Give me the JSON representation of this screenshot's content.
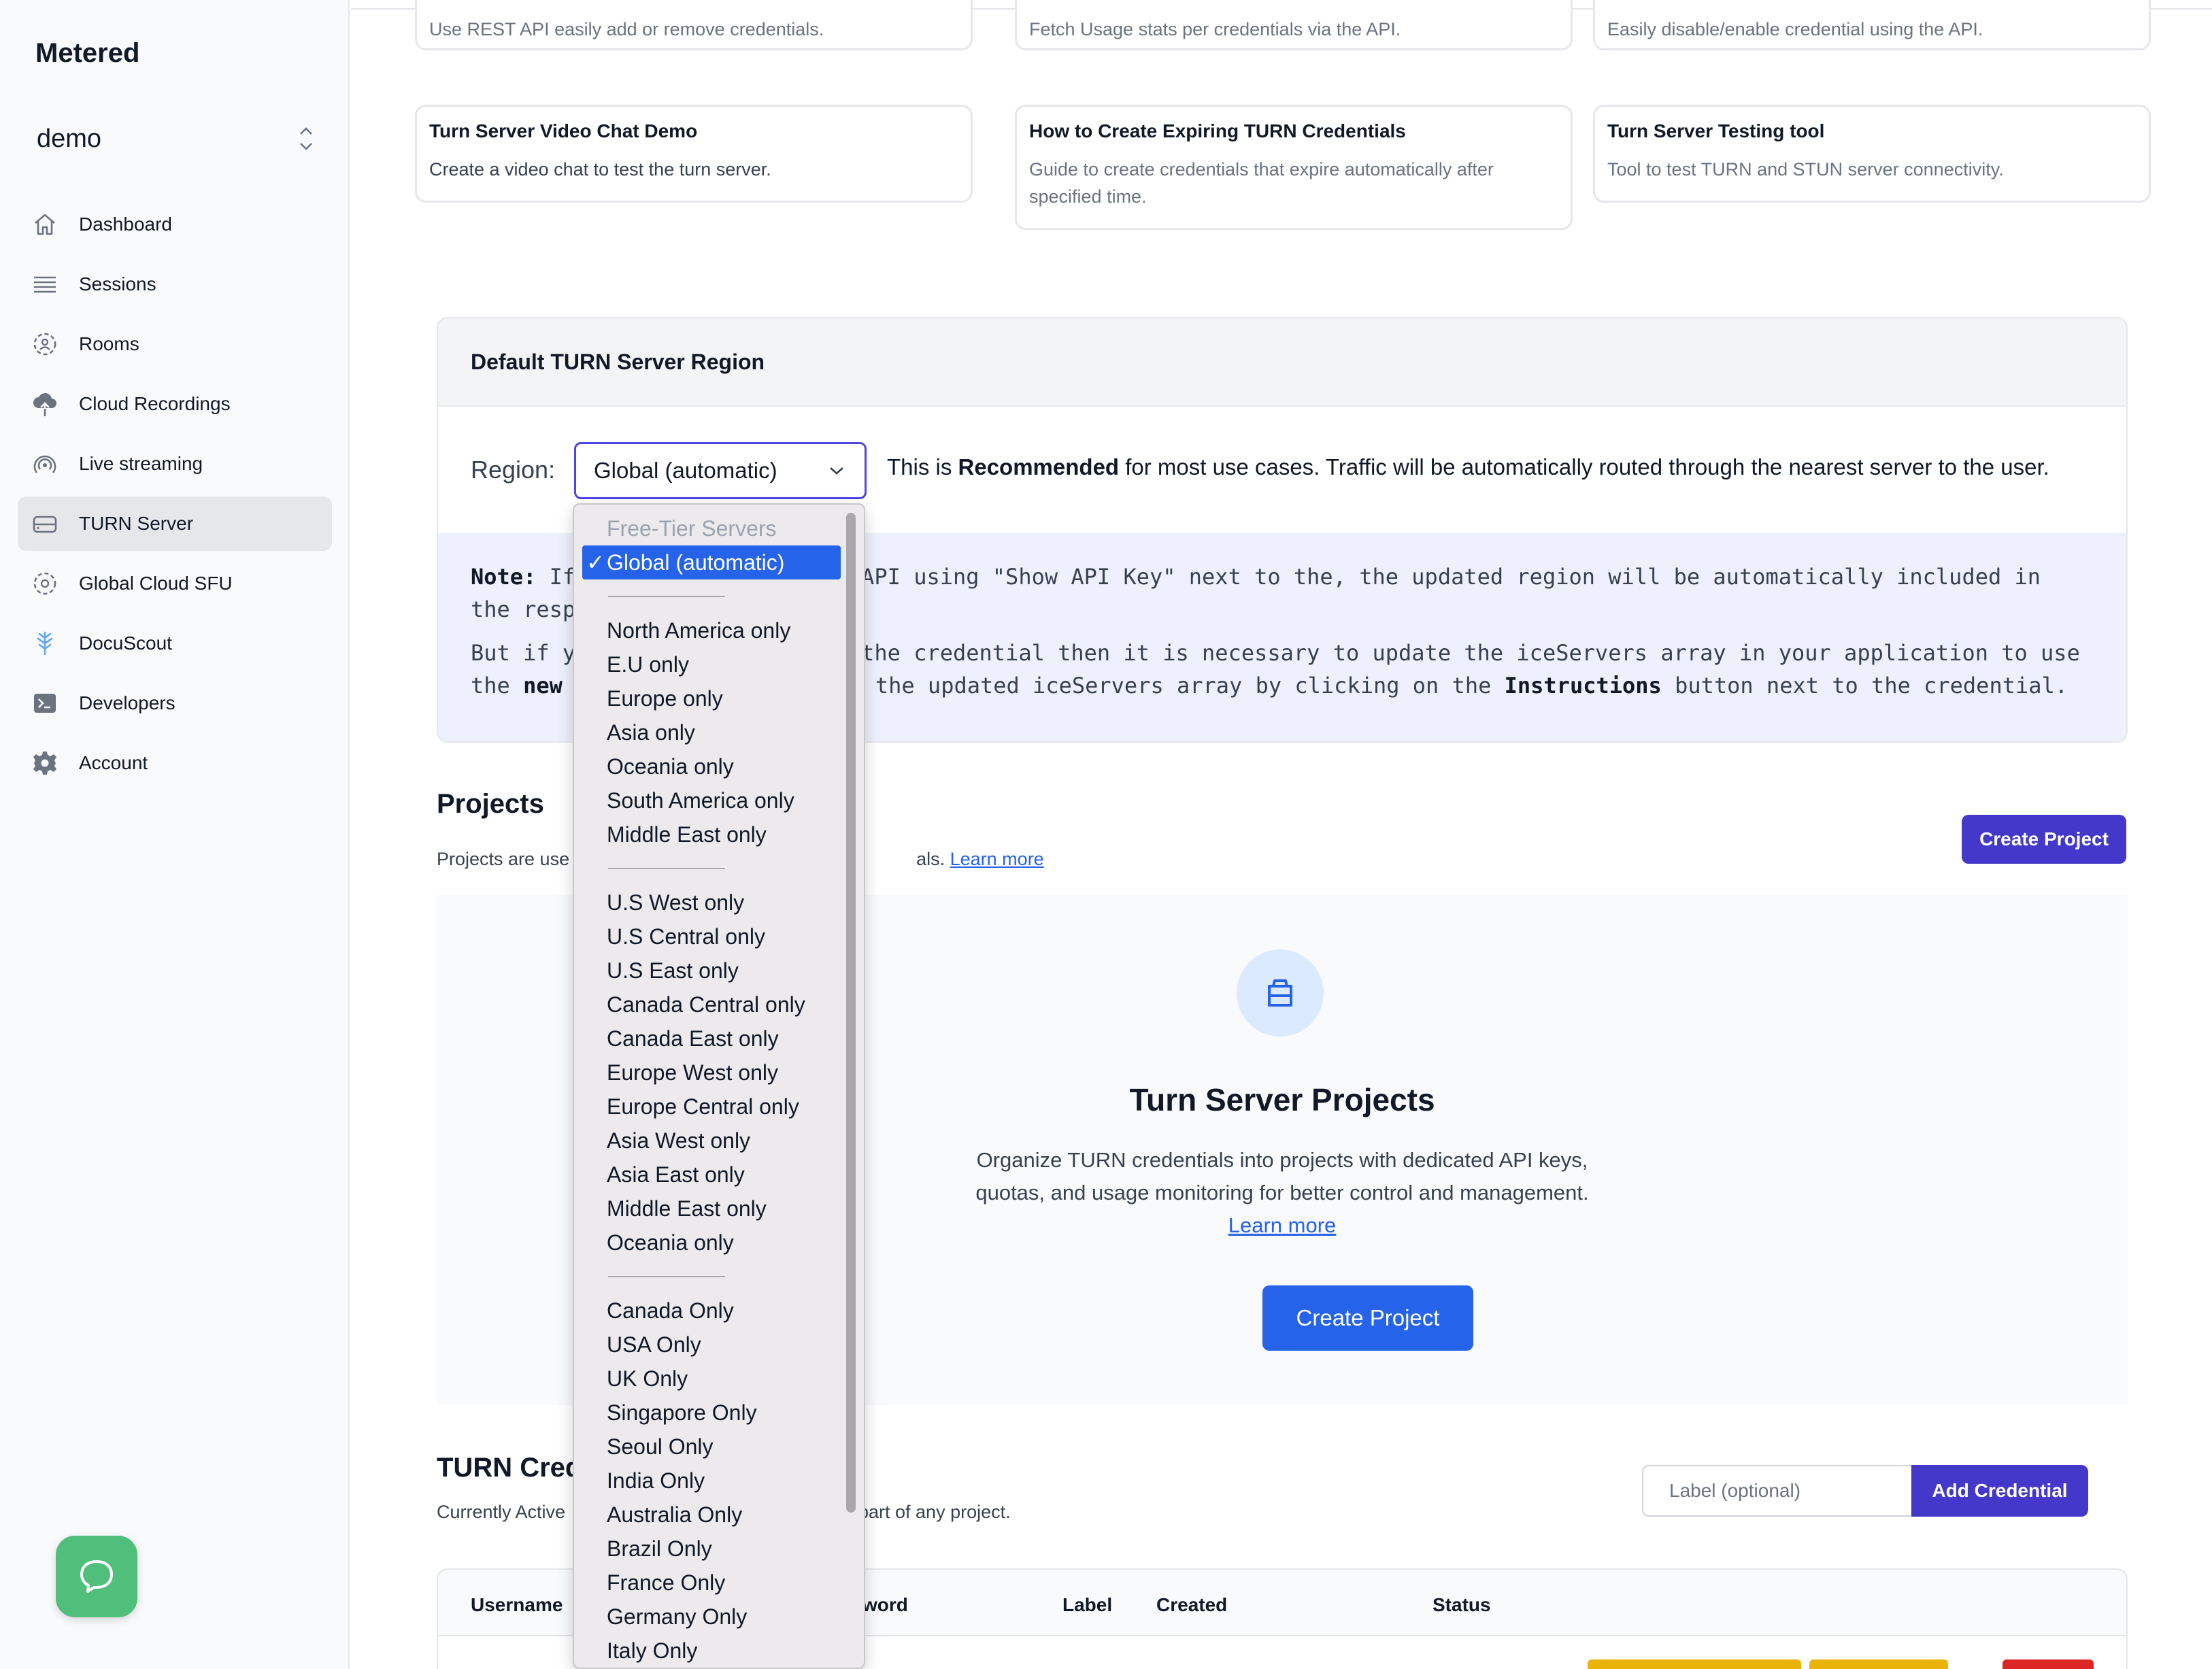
{
  "sidebar": {
    "brand": "Metered",
    "project": "demo",
    "items": [
      {
        "label": "Dashboard",
        "icon": "home-icon"
      },
      {
        "label": "Sessions",
        "icon": "list-icon"
      },
      {
        "label": "Rooms",
        "icon": "rooms-icon"
      },
      {
        "label": "Cloud Recordings",
        "icon": "cloud-upload-icon"
      },
      {
        "label": "Live streaming",
        "icon": "broadcast-icon"
      },
      {
        "label": "TURN Server",
        "icon": "server-icon",
        "active": true
      },
      {
        "label": "Global Cloud SFU",
        "icon": "sfu-icon"
      },
      {
        "label": "DocuScout",
        "icon": "docuscout-icon"
      },
      {
        "label": "Developers",
        "icon": "terminal-icon"
      },
      {
        "label": "Account",
        "icon": "gear-icon"
      }
    ]
  },
  "cards_top": [
    {
      "desc": "Use REST API easily add or remove credentials."
    },
    {
      "desc": "Fetch Usage stats per credentials via the API."
    },
    {
      "desc": "Easily disable/enable credential using the API."
    }
  ],
  "cards": [
    {
      "title": "Turn Server Video Chat Demo",
      "desc": "Create a video chat to test the turn server."
    },
    {
      "title": "How to Create Expiring TURN Credentials",
      "desc": "Guide to create credentials that expire automatically after specified time."
    },
    {
      "title": "Turn Server Testing tool",
      "desc": "Tool to test TURN and STUN server connectivity."
    }
  ],
  "region": {
    "header": "Default TURN Server Region",
    "label": "Region:",
    "selected": "Global (automatic)",
    "hint_prefix": "This is ",
    "hint_bold": "Recommended",
    "hint_suffix": " for most use cases. Traffic will be automatically routed through the nearest server to the user.",
    "note_label": "Note:",
    "note_line1_a": "If",
    "note_line1_b": "API using \"Show API Key\" next to the, the updated region will be automatically included in",
    "note_line1_c": "the resp",
    "note_line2_a": "But if y",
    "note_line2_b": "the credential then it is necessary to update the iceServers array in your application to use",
    "note_line2_c": "the ",
    "note_line2_new": "new",
    "note_line2_d": "the updated iceServers array by clicking on the ",
    "note_line2_instr": "Instructions",
    "note_line2_e": " button next to the credential."
  },
  "dropdown": {
    "group_label": "Free-Tier Servers",
    "selected": "Global (automatic)",
    "check": "✓",
    "group1": [
      "North America only",
      "E.U only",
      "Europe only",
      "Asia only",
      "Oceania only",
      "South America only",
      "Middle East only"
    ],
    "group2": [
      "U.S West only",
      "U.S Central only",
      "U.S East only",
      "Canada Central only",
      "Canada East only",
      "Europe West only",
      "Europe Central only",
      "Asia West only",
      "Asia East only",
      "Middle East only",
      "Oceania only"
    ],
    "group3": [
      "Canada Only",
      "USA Only",
      "UK Only",
      "Singapore Only",
      "Seoul Only",
      "India Only",
      "Australia Only",
      "Brazil Only",
      "France Only",
      "Germany Only",
      "Italy Only"
    ]
  },
  "projects": {
    "title": "Projects",
    "desc_start": "Projects are use",
    "desc_end": "als. ",
    "learn_more": "Learn more",
    "create_button": "Create Project",
    "empty_title": "Turn Server Projects",
    "empty_desc": "Organize TURN credentials into projects with dedicated API keys, quotas, and usage monitoring for better control and management.",
    "empty_learn_more": "Learn more",
    "empty_button": "Create Project",
    "empty_icon": "inbox-icon"
  },
  "credentials": {
    "title": "TURN Cred",
    "desc_start": "Currently Active",
    "desc_end": "part of any project.",
    "label_placeholder": "Label (optional)",
    "add_button": "Add Credential",
    "columns": [
      "Username",
      "word",
      "Label",
      "Created",
      "Status"
    ]
  },
  "colors": {
    "accent": "#4338ca",
    "primary_blue": "#2563eb",
    "chat_green": "#4fbf7b",
    "row_button_yellow": "#eab308",
    "row_button_red": "#dc2626"
  }
}
